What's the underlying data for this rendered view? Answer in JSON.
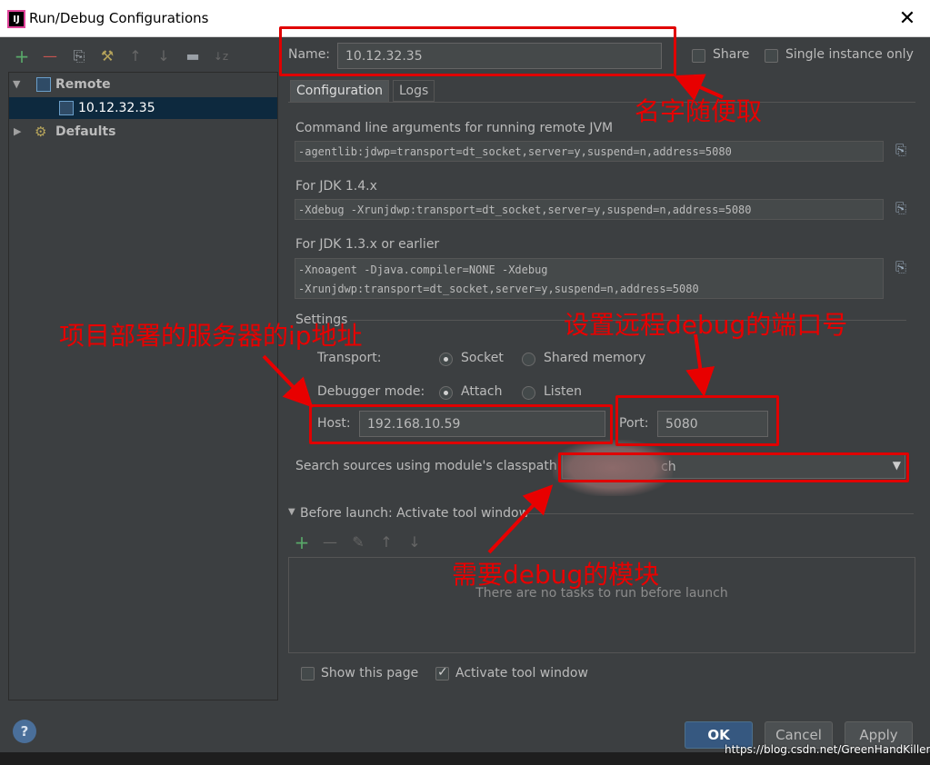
{
  "window": {
    "logo": "IJ",
    "title": "Run/Debug Configurations",
    "close": "✕"
  },
  "toolbar": {
    "add": "+",
    "remove": "—",
    "copy": "⎘",
    "edit": "⚒",
    "up": "↑",
    "down": "↓",
    "folder": "▬",
    "sort": "↓z"
  },
  "tree": {
    "remote_label": "Remote",
    "remote_child": "10.12.32.35",
    "defaults_label": "Defaults"
  },
  "name_field": {
    "label": "Name:",
    "value": "10.12.32.35"
  },
  "share": {
    "label": "Share",
    "checked": false
  },
  "single_instance": {
    "label": "Single instance only",
    "checked": false
  },
  "tabs": [
    {
      "label": "Configuration",
      "active": true
    },
    {
      "label": "Logs",
      "active": false
    }
  ],
  "cmd": {
    "label": "Command line arguments for running remote JVM",
    "value": "-agentlib:jdwp=transport=dt_socket,server=y,suspend=n,address=5080"
  },
  "jdk14": {
    "label": "For JDK 1.4.x",
    "value": "-Xdebug -Xrunjdwp:transport=dt_socket,server=y,suspend=n,address=5080"
  },
  "jdk13": {
    "label": "For JDK 1.3.x or earlier",
    "line1": "-Xnoagent -Djava.compiler=NONE -Xdebug",
    "line2": "-Xrunjdwp:transport=dt_socket,server=y,suspend=n,address=5080"
  },
  "settings": {
    "label": "Settings",
    "transport_label": "Transport:",
    "socket_label": "Socket",
    "shared_memory_label": "Shared memory",
    "debugger_mode_label": "Debugger mode:",
    "attach_label": "Attach",
    "listen_label": "Listen",
    "host_label": "Host:",
    "host_value": "192.168.10.59",
    "port_label": "Port:",
    "port_value": "5080",
    "classpath_label": "Search sources using module's classpath",
    "classpath_value_visible": "ch"
  },
  "before_launch": {
    "label": "Before launch: Activate tool window",
    "add": "+",
    "remove": "—",
    "edit": "✎",
    "up": "↑",
    "down": "↓",
    "empty": "There are no tasks to run before launch"
  },
  "show_page": {
    "label": "Show this page",
    "checked": false
  },
  "activate_tool": {
    "label": "Activate tool window",
    "checked": true
  },
  "buttons": {
    "help": "?",
    "ok": "OK",
    "cancel": "Cancel",
    "apply": "Apply"
  },
  "annotations": {
    "name_note": "名字随便取",
    "host_note": "项目部署的服务器的ip地址",
    "port_note": "设置远程debug的端口号",
    "module_note": "需要debug的模块",
    "color": "#e80000"
  },
  "watermark": "https://blog.csdn.net/GreenHandKiller"
}
